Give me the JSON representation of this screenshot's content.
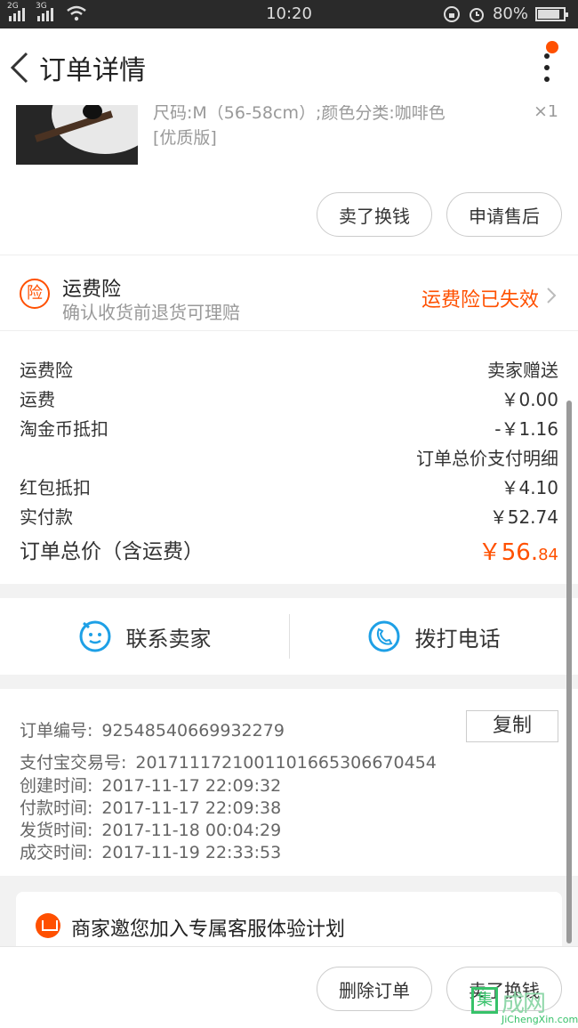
{
  "status_bar": {
    "sim1": "2G",
    "sim2": "3G",
    "time": "10:20",
    "battery": "80%"
  },
  "nav": {
    "title": "订单详情"
  },
  "item": {
    "spec_line": "尺码:M（56-58cm）;颜色分类:咖啡色",
    "spec_line2": "[优质版]",
    "qty": "×1",
    "sell_label": "卖了换钱",
    "aftersale_label": "申请售后"
  },
  "insurance": {
    "icon_text": "险",
    "title": "运费险",
    "subtitle": "确认收货前退货可理赔",
    "status": "运费险已失效"
  },
  "fees": {
    "rows": [
      {
        "label": "运费险",
        "value": "卖家赠送"
      },
      {
        "label": "运费",
        "value": "￥0.00"
      },
      {
        "label": "淘金币抵扣",
        "value": "-￥1.16"
      },
      {
        "label": "",
        "value": "订单总价支付明细"
      },
      {
        "label": "红包抵扣",
        "value": "￥4.10"
      },
      {
        "label": "实付款",
        "value": "￥52.74"
      }
    ],
    "total_label": "订单总价（含运费）",
    "total_main": "￥56.",
    "total_cents": "84",
    "accent_color": "#ff5000"
  },
  "contact": {
    "seller_label": "联系卖家",
    "phone_label": "拨打电话",
    "icon_color": "#1ea0e6"
  },
  "order": {
    "copy_label": "复制",
    "rows": [
      {
        "label": "订单编号:",
        "value": "92548540669932279"
      },
      {
        "label": "支付宝交易号:",
        "value": "2017111721001101665306670454"
      },
      {
        "label": "创建时间:",
        "value": "2017-11-17 22:09:32"
      },
      {
        "label": "付款时间:",
        "value": "2017-11-17 22:09:38"
      },
      {
        "label": "发货时间:",
        "value": "2017-11-18 00:04:29"
      },
      {
        "label": "成交时间:",
        "value": "2017-11-19 22:33:53"
      }
    ]
  },
  "promo": {
    "text": "商家邀您加入专属客服体验计划"
  },
  "bottom": {
    "delete_label": "删除订单",
    "sell_label": "卖了换钱"
  },
  "watermark": {
    "box_char": "集",
    "cn": "成网",
    "en": "JiChengXin.com"
  }
}
